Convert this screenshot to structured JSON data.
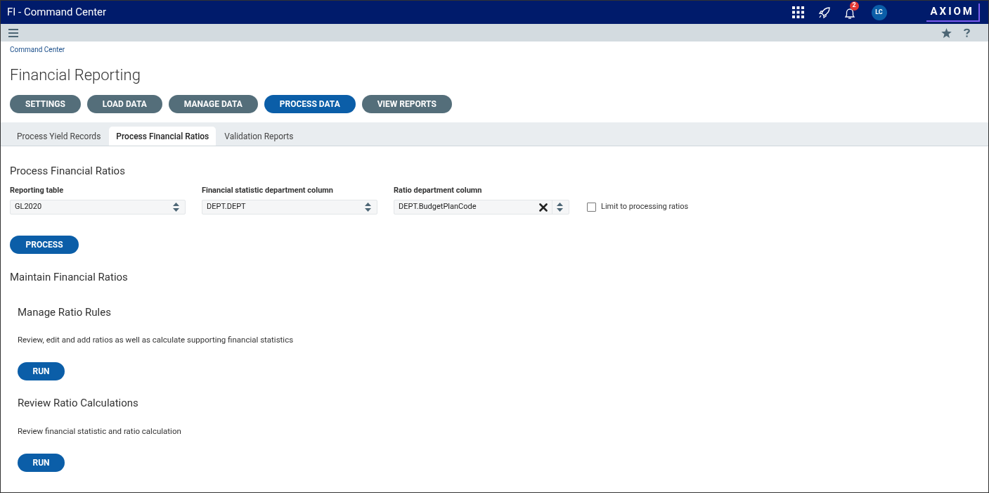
{
  "header": {
    "title": "FI - Command Center",
    "notification_count": "2",
    "avatar": "LC",
    "logo": "AXIOM"
  },
  "breadcrumb": "Command Center",
  "page_title": "Financial Reporting",
  "nav_buttons": [
    {
      "label": "SETTINGS",
      "selected": false
    },
    {
      "label": "LOAD DATA",
      "selected": false
    },
    {
      "label": "MANAGE DATA",
      "selected": false
    },
    {
      "label": "PROCESS DATA",
      "selected": true
    },
    {
      "label": "VIEW REPORTS",
      "selected": false
    }
  ],
  "tabs": [
    {
      "label": "Process Yield Records",
      "selected": false
    },
    {
      "label": "Process Financial Ratios",
      "selected": true
    },
    {
      "label": "Validation Reports",
      "selected": false
    }
  ],
  "process_section": {
    "title": "Process Financial Ratios",
    "fields": [
      {
        "label": "Reporting table",
        "value": "GL2020",
        "clearable": false
      },
      {
        "label": "Financial statistic department column",
        "value": "DEPT.DEPT",
        "clearable": false
      },
      {
        "label": "Ratio department column",
        "value": "DEPT.BudgetPlanCode",
        "clearable": true
      }
    ],
    "checkbox": {
      "label": "Limit to processing ratios",
      "checked": false
    },
    "button": "PROCESS"
  },
  "maintain_section": {
    "title": "Maintain Financial Ratios",
    "tasks": [
      {
        "title": "Manage Ratio Rules",
        "description": "Review, edit and add ratios as well as calculate supporting financial statistics",
        "button": "RUN"
      },
      {
        "title": "Review Ratio Calculations",
        "description": "Review financial statistic and ratio calculation",
        "button": "RUN"
      }
    ]
  }
}
